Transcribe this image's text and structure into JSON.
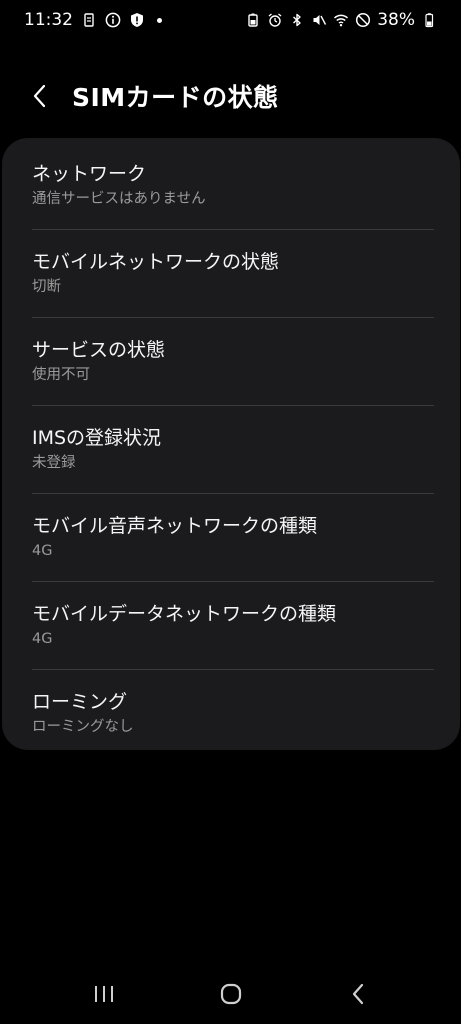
{
  "status_bar": {
    "time": "11:32",
    "battery_percent": "38%",
    "icons_left": [
      "sim-icon",
      "info-icon",
      "shield-alert-icon",
      "dot"
    ],
    "icons_right": [
      "battery-saver-icon",
      "alarm-icon",
      "bluetooth-icon",
      "mute-icon",
      "wifi-icon",
      "do-not-disturb-icon",
      "battery-icon"
    ]
  },
  "header": {
    "title": "SIMカードの状態"
  },
  "items": [
    {
      "title": "ネットワーク",
      "subtitle": "通信サービスはありません"
    },
    {
      "title": "モバイルネットワークの状態",
      "subtitle": "切断"
    },
    {
      "title": "サービスの状態",
      "subtitle": "使用不可"
    },
    {
      "title": "IMSの登録状況",
      "subtitle": "未登録"
    },
    {
      "title": "モバイル音声ネットワークの種類",
      "subtitle": "4G"
    },
    {
      "title": "モバイルデータネットワークの種類",
      "subtitle": "4G"
    },
    {
      "title": "ローミング",
      "subtitle": "ローミングなし"
    }
  ],
  "nav_bar": {
    "buttons": [
      "recent-apps-icon",
      "home-icon",
      "back-icon"
    ]
  },
  "colors": {
    "background": "#000000",
    "card": "#1b1b1d",
    "divider": "#3a3a3c",
    "title_text": "#f5f5f5",
    "subtitle_text": "#9a9a9a"
  }
}
